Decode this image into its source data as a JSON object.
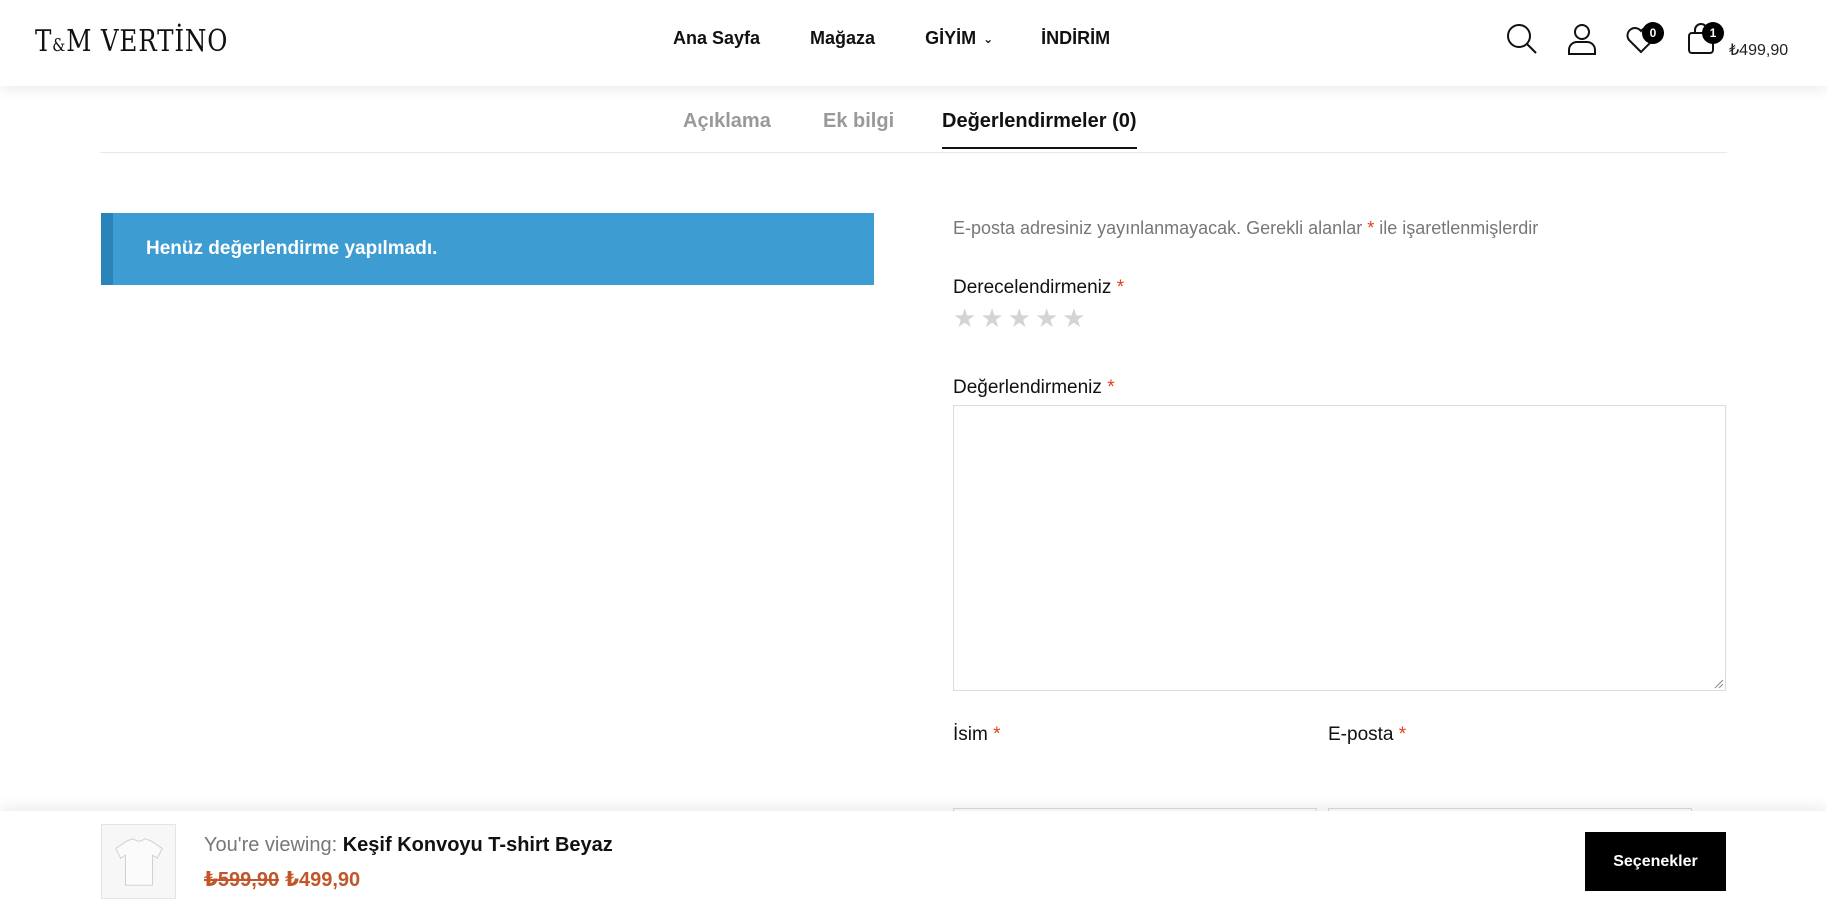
{
  "header": {
    "logo": {
      "main": "T",
      "amp": "&",
      "rest": "M VERTİNO"
    },
    "nav": [
      {
        "label": "Ana Sayfa"
      },
      {
        "label": "Mağaza"
      },
      {
        "label": "GİYİM"
      },
      {
        "label": "İNDİRİM"
      }
    ],
    "icons": {
      "search": "search-icon",
      "account": "user-icon",
      "wishlist": "heart-icon",
      "cart": "shopping-bag-icon"
    },
    "wishlist_count": "0",
    "cart_count": "1",
    "cart_total": "₺499,90"
  },
  "tabs": [
    {
      "label": "Açıklama"
    },
    {
      "label": "Ek bilgi"
    },
    {
      "label": "Değerlendirmeler (0)"
    }
  ],
  "reviews": {
    "empty_notice": "Henüz değerlendirme yapılmadı."
  },
  "form": {
    "note_before": "E-posta adresiniz yayınlanmayacak. Gerekli alanlar",
    "note_required": "*",
    "note_after": "ile işaretlenmişlerdir",
    "rating_label": "Derecelendirmeniz",
    "required_mark": "*",
    "stars": [
      "★",
      "★",
      "★",
      "★",
      "★"
    ],
    "review_label": "Değerlendirmeniz",
    "review_value": "",
    "name_label": "İsim",
    "email_label": "E-posta"
  },
  "sticky": {
    "viewing_prefix": "You're viewing:",
    "product_name": "Keşif Konvoyu T-shirt Beyaz",
    "old_price": "₺599,90",
    "price": "₺499,90",
    "options_button": "Seçenekler"
  },
  "colors": {
    "notice_bg": "#3d9cd2",
    "price": "#c0562a",
    "required": "#e2401c"
  }
}
